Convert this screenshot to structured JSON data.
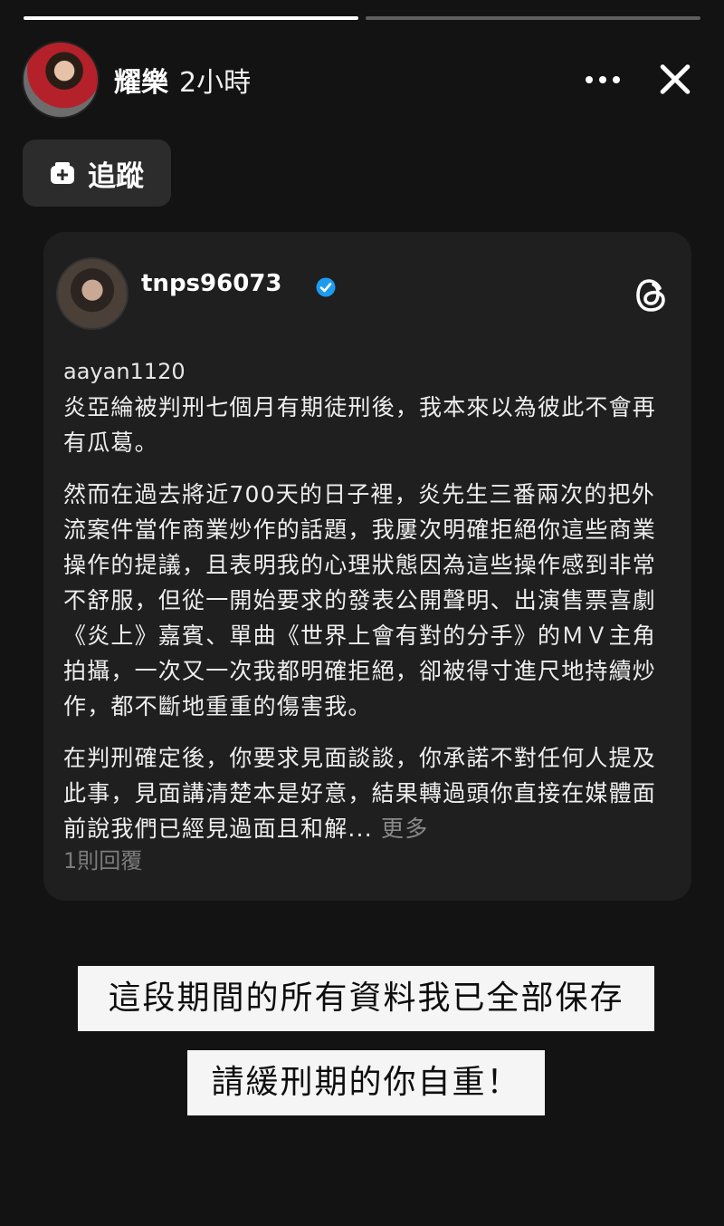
{
  "story": {
    "progress": [
      1.0,
      0.0
    ]
  },
  "header": {
    "user_name": "耀樂",
    "time_ago": "2小時"
  },
  "follow_button": {
    "label": "追蹤"
  },
  "card": {
    "handle": "tnps96073",
    "reply_user": "aayan1120",
    "paragraphs": [
      "炎亞綸被判刑七個月有期徒刑後，我本來以為彼此不會再有瓜葛。",
      "然而在過去將近700天的日子裡，炎先生三番兩次的把外流案件當作商業炒作的話題，我屢次明確拒絕你這些商業操作的提議，且表明我的心理狀態因為這些操作感到非常不舒服，但從一開始要求的發表公開聲明、出演售票喜劇《炎上》嘉賓、單曲《世界上會有對的分手》的ＭＶ主角拍攝，一次又一次我都明確拒絕，卻被得寸進尺地持續炒作，都不斷地重重的傷害我。",
      "在判刑確定後，你要求見面談談，你承諾不對任何人提及此事，見面講清楚本是好意，結果轉過頭你直接在媒體面前說我們已經見過面且和解..."
    ],
    "more_label": "更多",
    "reply_count": "1則回覆"
  },
  "stickers": [
    "這段期間的所有資料我已全部保存",
    "請緩刑期的你自重！"
  ],
  "colors": {
    "background": "#131313",
    "card": "#1f1f1f",
    "verified": "#1d9bf0"
  }
}
